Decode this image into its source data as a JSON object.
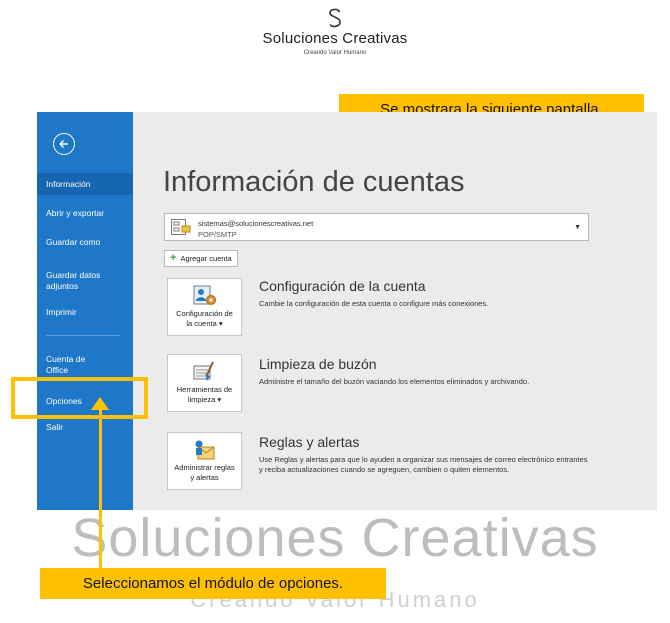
{
  "brand": {
    "name": "Soluciones Creativas",
    "tagline": "Creando Valor Humano"
  },
  "annotations": {
    "top_callout": "Se mostrara la siguiente pantalla.",
    "bottom_callout": "Seleccionamos el módulo de opciones."
  },
  "sidebar": {
    "items": [
      {
        "label": "Información"
      },
      {
        "label": "Abrir y exportar"
      },
      {
        "label": "Guardar como"
      },
      {
        "label": "Guardar datos adjuntos"
      },
      {
        "label": "Imprimir"
      },
      {
        "label": "Cuenta de Office"
      },
      {
        "label": "Opciones"
      },
      {
        "label": "Salir"
      }
    ]
  },
  "main": {
    "title": "Información de cuentas",
    "account": {
      "email": "sistemas@solucionescreativas.net",
      "type": "POP/SMTP"
    },
    "add_account_label": "Agregar cuenta",
    "sections": [
      {
        "button_label": "Configuración de la cuenta ▾",
        "title": "Configuración de la cuenta",
        "description": "Cambie la configuración de esta cuenta o configure más conexiones."
      },
      {
        "button_label": "Herramientas de limpieza ▾",
        "title": "Limpieza de buzón",
        "description": "Administre el tamaño del buzón vaciando los elementos eliminados y archivando."
      },
      {
        "button_label": "Administrar reglas y alertas",
        "title": "Reglas y alertas",
        "description": "Use Reglas y alertas para que lo ayuden a organizar sus mensajes de correo electrónico entrantes y reciba actualizaciones cuando se agreguen, cambien o quiten elementos."
      }
    ]
  },
  "colors": {
    "sidebar": "#1f77c9",
    "sidebar_active": "#1565b0",
    "accent": "#ffc000",
    "content_bg": "#ebebeb"
  }
}
